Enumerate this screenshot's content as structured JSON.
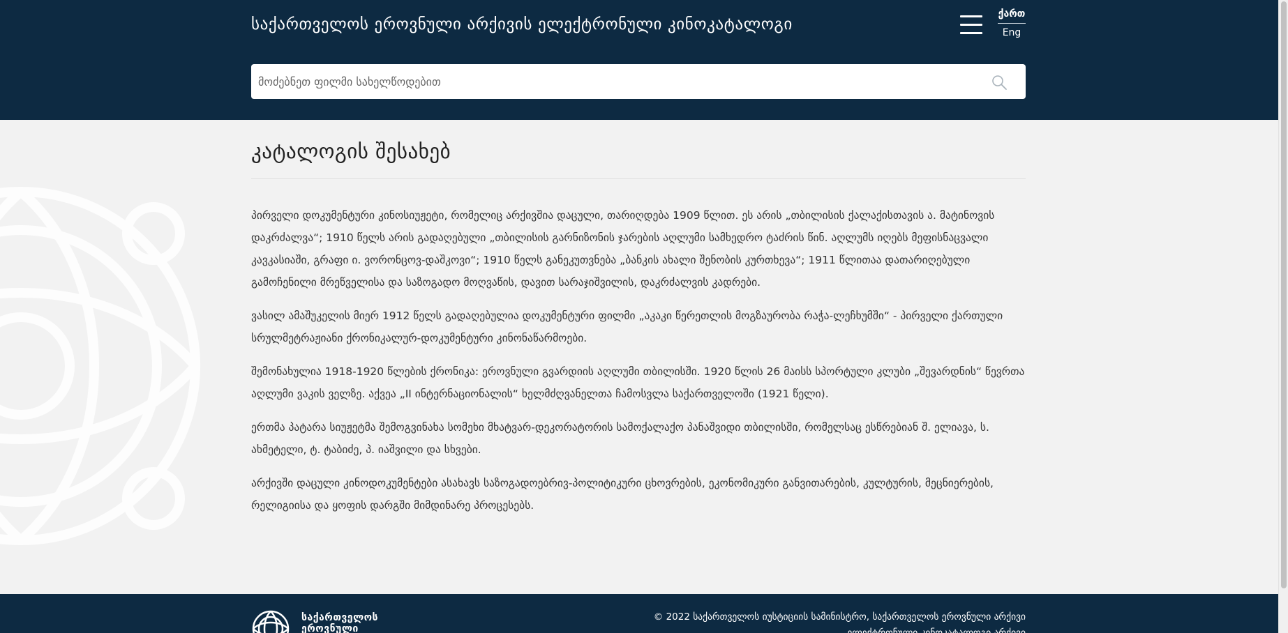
{
  "header": {
    "title": "საქართველოს ეროვნული არქივის ელექტრონული კინოკატალოგი",
    "lang_ka": "ქართ",
    "lang_en": "Eng",
    "menu_icon": "hamburger-icon"
  },
  "search": {
    "placeholder": "მოძებნეთ ფილმი სახელწოდებით",
    "icon": "search-icon"
  },
  "main": {
    "heading": "კატალოგის შესახებ",
    "paragraphs": [
      "პირველი დოკუმენტური კინოსიუჟეტი, რომელიც არქივშია დაცული, თარიღდება 1909 წლით. ეს არის „თბილისის ქალაქისთავის ა. მატინოვის დაკრძალვა“; 1910 წელს არის გადაღებული „თბილისის გარნიზონის ჯარების აღლუმი სამხედრო ტაძრის წინ. აღლუმს იღებს მეფისნაცვალი კავკასიაში, გრაფი ი. ვორონცოვ-დაშკოვი“; 1910 წელს განეკუთვნება „ბანკის ახალი შენობის კურთხევა“; 1911 წლითაა დათარიღებული გამოჩენილი მრეწველისა და საზოგადო მოღვაწის, დავით სარაჯიშვილის, დაკრძალვის კადრები.",
      "ვასილ ამაშუკელის მიერ 1912 წელს გადაღებულია დოკუმენტური ფილმი „აკაკი წერეთლის მოგზაურობა რაჭა-ლეჩხუმში“ - პირველი ქართული სრულმეტრაჟიანი ქრონიკალურ-დოკუმენტური კინონაწარმოები.",
      "შემონახულია 1918-1920 წლების ქრონიკა: ეროვნული გვარდიის აღლუმი თბილისში. 1920 წლის 26 მაისს სპორტული კლუბი „შევარდნის“ წევრთა აღლუმი ვაკის ველზე. აქვეა „II ინტერნაციონალის“ ხელმძღვანელთა ჩამოსვლა საქართველოში (1921 წელი).",
      "ერთმა პატარა სიუჟეტმა შემოგვინახა სომეხი მხატვარ-დეკორატორის სამოქალაქო პანაშვიდი თბილისში, რომელსაც ესწრებიან შ. ელიავა, ს. ახმეტელი, ტ. ტაბიძე, პ. იაშვილი და სხვები.",
      "არქივში დაცული კინოდოკუმენტები ასახავს საზოგადოებრივ-პოლიტიკური ცხოვრების, ეკონომიკური განვითარების, კულტურის, მეცნიერების, რელიგიისა და ყოფის დარგში მიმდინარე პროცესებს."
    ]
  },
  "footer": {
    "logo_line1": "საქართველოს",
    "logo_line2": "ეროვნული",
    "copyright_line1": "© 2022 საქართველოს იუსტიციის სამინისტრო, საქართველოს ეროვნული არქივი",
    "copyright_line2": "ელექტრონული კინოკატალოგი არქივი"
  }
}
